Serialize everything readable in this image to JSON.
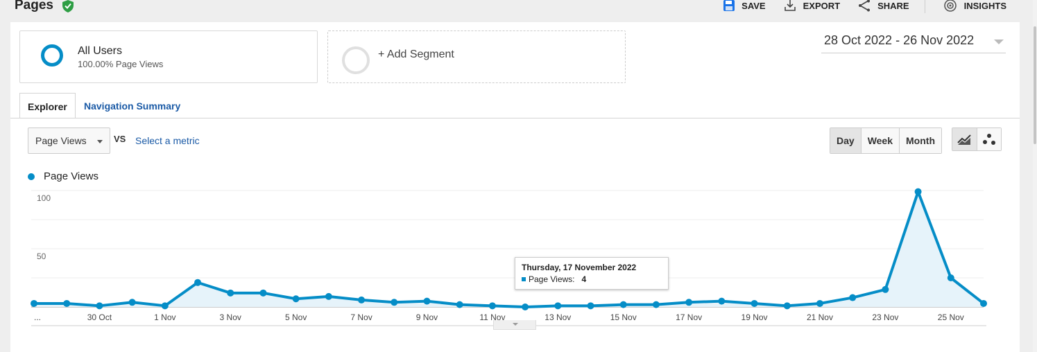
{
  "header": {
    "title": "Pages",
    "toolbar": {
      "save_label": "SAVE",
      "export_label": "EXPORT",
      "share_label": "SHARE",
      "insights_label": "INSIGHTS"
    }
  },
  "segments": {
    "all_users": {
      "name": "All Users",
      "subtitle": "100.00% Page Views"
    },
    "add_segment_label": "+ Add Segment"
  },
  "date_range": "28 Oct 2022 - 26 Nov 2022",
  "tabs": [
    {
      "label": "Explorer",
      "active": true
    },
    {
      "label": "Navigation Summary",
      "active": false
    }
  ],
  "controls": {
    "metric_selected": "Page Views",
    "vs_label": "VS",
    "select_metric_label": "Select a metric",
    "granularity": [
      "Day",
      "Week",
      "Month"
    ],
    "granularity_active": "Day",
    "chart_types": [
      "line-chart-icon",
      "motion-chart-icon"
    ]
  },
  "colors": {
    "series": "#058dc7",
    "link": "#1a5aa6",
    "verified": "#2e9e44"
  },
  "tooltip": {
    "title": "Thursday, 17 November 2022",
    "metric": "Page Views:",
    "value": "4"
  },
  "chart_data": {
    "type": "area",
    "legend": "Page Views",
    "series": [
      {
        "name": "Page Views",
        "x": [
          "28 Oct",
          "29 Oct",
          "30 Oct",
          "31 Oct",
          "1 Nov",
          "2 Nov",
          "3 Nov",
          "4 Nov",
          "5 Nov",
          "6 Nov",
          "7 Nov",
          "8 Nov",
          "9 Nov",
          "10 Nov",
          "11 Nov",
          "12 Nov",
          "13 Nov",
          "14 Nov",
          "15 Nov",
          "16 Nov",
          "17 Nov",
          "18 Nov",
          "19 Nov",
          "20 Nov",
          "21 Nov",
          "22 Nov",
          "23 Nov",
          "24 Nov",
          "25 Nov",
          "26 Nov"
        ],
        "values": [
          3,
          3,
          1,
          4,
          1,
          21,
          12,
          12,
          7,
          9,
          6,
          4,
          5,
          2,
          1,
          0,
          1,
          1,
          2,
          2,
          4,
          5,
          3,
          1,
          3,
          8,
          15,
          99,
          25,
          3
        ]
      }
    ],
    "y_ticks": [
      "100",
      "50"
    ],
    "x_tick_labels": [
      "...",
      "30 Oct",
      "1 Nov",
      "3 Nov",
      "5 Nov",
      "7 Nov",
      "9 Nov",
      "11 Nov",
      "13 Nov",
      "15 Nov",
      "17 Nov",
      "19 Nov",
      "21 Nov",
      "23 Nov",
      "25 Nov"
    ],
    "ylim": [
      0,
      100
    ],
    "grid": true
  }
}
